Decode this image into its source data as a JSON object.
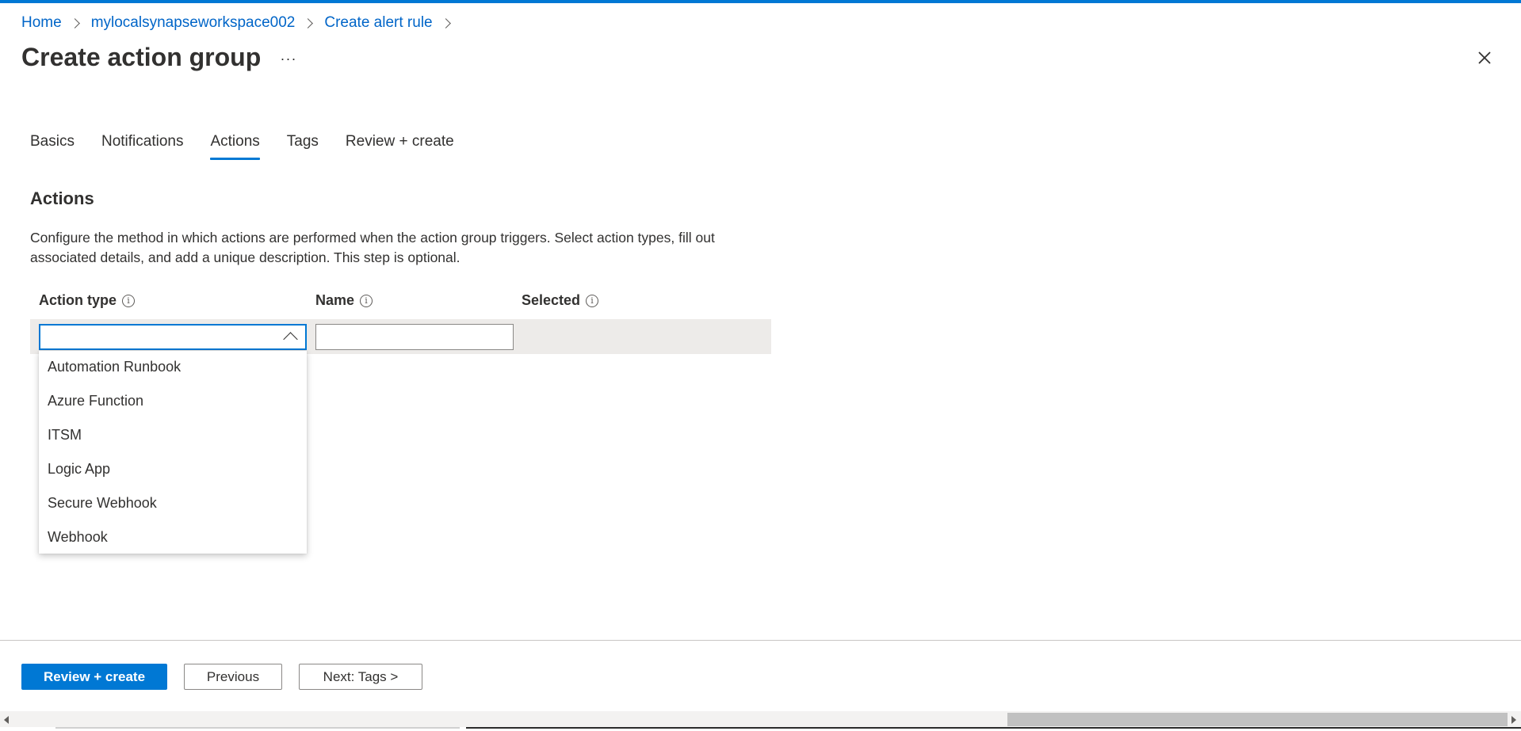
{
  "breadcrumb": {
    "items": [
      "Home",
      "mylocalsynapseworkspace002",
      "Create alert rule"
    ]
  },
  "page": {
    "title": "Create action group",
    "more_label": "···"
  },
  "tabs": [
    {
      "label": "Basics",
      "active": false
    },
    {
      "label": "Notifications",
      "active": false
    },
    {
      "label": "Actions",
      "active": true
    },
    {
      "label": "Tags",
      "active": false
    },
    {
      "label": "Review + create",
      "active": false
    }
  ],
  "actions": {
    "heading": "Actions",
    "description": "Configure the method in which actions are performed when the action group triggers. Select action types, fill out associated details, and add a unique description. This step is optional.",
    "columns": {
      "action_type": "Action type",
      "name": "Name",
      "selected": "Selected"
    },
    "row": {
      "action_type_value": "",
      "name_value": ""
    },
    "dropdown_options": [
      "Automation Runbook",
      "Azure Function",
      "ITSM",
      "Logic App",
      "Secure Webhook",
      "Webhook"
    ]
  },
  "footer": {
    "primary_label": "Review + create",
    "previous_label": "Previous",
    "next_label": "Next: Tags >"
  },
  "colors": {
    "accent": "#0078d4",
    "link": "#0065c8",
    "row_band": "#edebe9"
  }
}
